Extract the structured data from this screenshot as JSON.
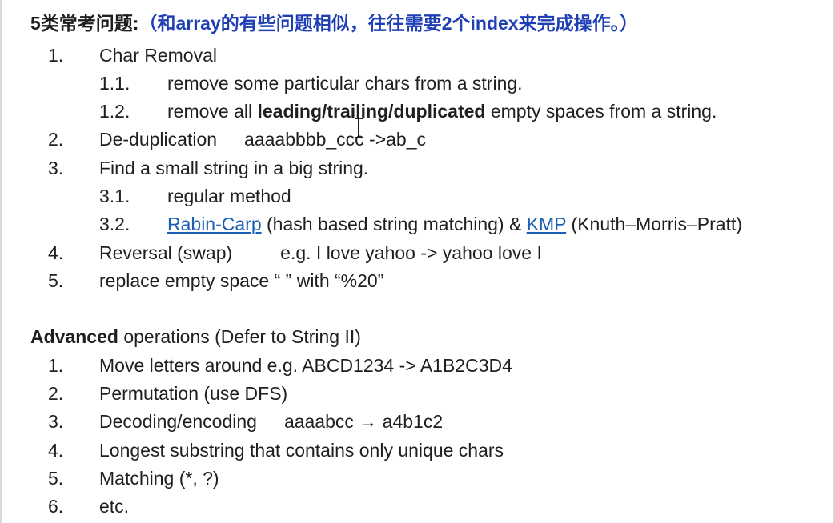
{
  "heading": {
    "main": "5类常考问题:",
    "paren": "（和array的有些问题相似，往往需要2个index来完成操作。）"
  },
  "basic": [
    {
      "num": "1.",
      "text": "Char Removal"
    },
    {
      "num": "2.",
      "text": "De-duplication",
      "example": "aaaabbbb_ccc ->ab_c"
    },
    {
      "num": "3.",
      "text": "Find a small string in a big string."
    },
    {
      "num": "4.",
      "text": "Reversal (swap)",
      "example": "e.g.  I love yahoo ->  yahoo love I"
    },
    {
      "num": "5.",
      "text": "replace empty space “ ” with “%20”"
    }
  ],
  "sub1": [
    {
      "num": "1.1.",
      "text": "remove some particular chars from a string."
    },
    {
      "num": "1.2.",
      "pre": "remove all ",
      "bold": "leading/trailing/duplicated",
      "post": " empty spaces from a string."
    }
  ],
  "sub3": [
    {
      "num": "3.1.",
      "text": "regular method"
    },
    {
      "num": "3.2.",
      "link1": "Rabin-Carp",
      "mid": " (hash based string matching) & ",
      "link2": "KMP",
      "post": " (Knuth–Morris–Pratt)"
    }
  ],
  "advanced": {
    "title_bold": "Advanced",
    "title_rest": " operations (Defer to String II)",
    "items": [
      {
        "num": "1.",
        "text": "Move letters around  e.g.  ABCD1234 -> A1B2C3D4"
      },
      {
        "num": "2.",
        "text": "Permutation (use DFS)"
      },
      {
        "num": "3.",
        "text": "Decoding/encoding",
        "example": "aaaabcc → a4b1c2"
      },
      {
        "num": "4.",
        "text": "Longest substring that contains only unique chars"
      },
      {
        "num": "5.",
        "text": "Matching (*, ?)"
      },
      {
        "num": "6.",
        "text": "etc."
      }
    ]
  },
  "colors": {
    "heading_paren": "#1f3fb5",
    "link": "#1a5fb4",
    "text": "#1f1f1f"
  },
  "icons": [
    "text-cursor-icon"
  ]
}
